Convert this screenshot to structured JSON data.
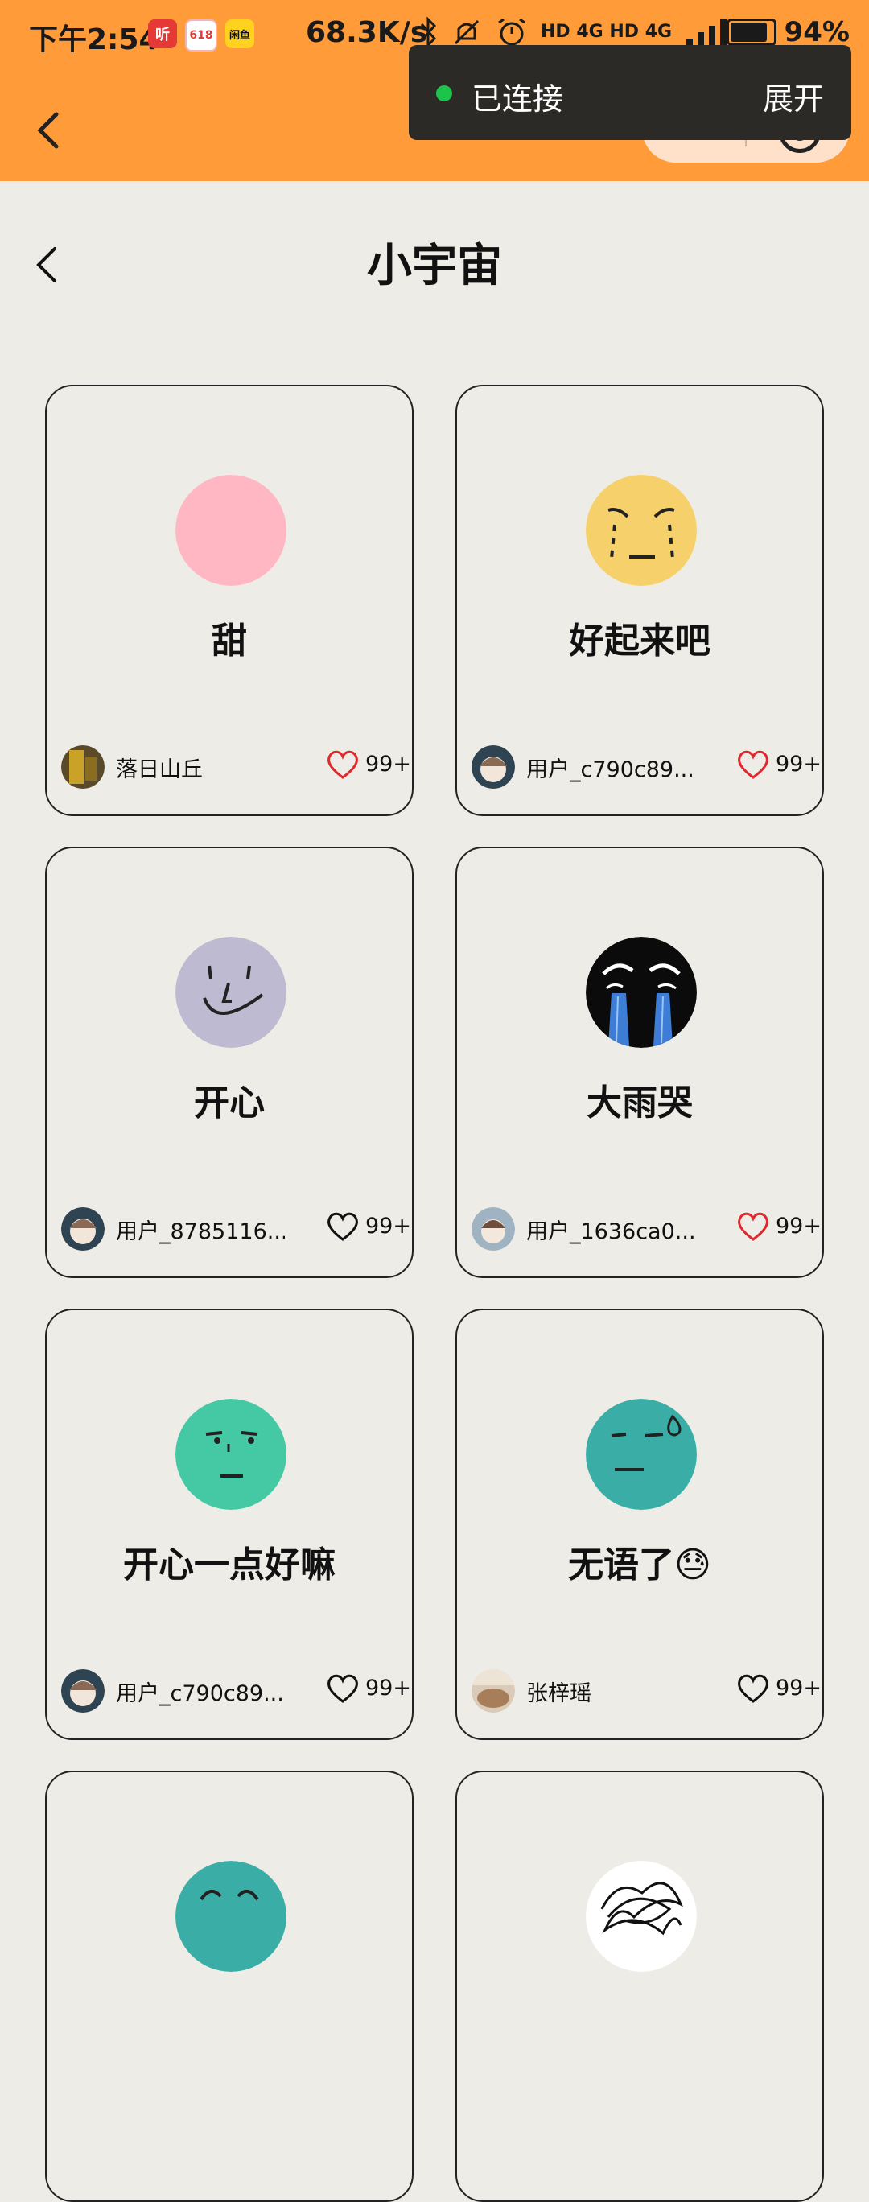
{
  "status_bar": {
    "time": "下午2:54",
    "badges": [
      "听",
      "618",
      "闲鱼"
    ],
    "net_speed": "68.3K/s",
    "icons": [
      "bluetooth-icon",
      "mute-icon",
      "alarm-icon",
      "hd-icon",
      "signal-4g-icon",
      "hd-icon",
      "signal-4g-icon"
    ],
    "right_text": "HD 4G HD 4G",
    "battery": "94%",
    "battery_level": 0.94
  },
  "connection_toast": {
    "label": "已连接",
    "expand": "展开"
  },
  "page": {
    "title": "小宇宙"
  },
  "colors": {
    "top_bar": "#FF9C39",
    "page_bg": "#EEECE6",
    "heart_liked": "#E0282E"
  },
  "cards": [
    {
      "name": "甜",
      "emoji": "pink-circle",
      "user": "落日山丘",
      "likes": "99+",
      "liked": true
    },
    {
      "name": "好起来吧",
      "emoji": "crying-yellow-face",
      "user": "用户_c790c89...",
      "likes": "99+",
      "liked": true
    },
    {
      "name": "开心",
      "emoji": "smiling-lavender-face",
      "user": "用户_8785116...",
      "likes": "99+",
      "liked": false
    },
    {
      "name": "大雨哭",
      "emoji": "heavy-crying-black-face",
      "user": "用户_1636ca0...",
      "likes": "99+",
      "liked": true
    },
    {
      "name": "开心一点好嘛",
      "emoji": "neutral-green-face",
      "user": "用户_c790c89...",
      "likes": "99+",
      "liked": false
    },
    {
      "name": "无语了😓",
      "emoji": "sweat-teal-face",
      "user": "张梓瑶",
      "likes": "99+",
      "liked": false
    }
  ]
}
